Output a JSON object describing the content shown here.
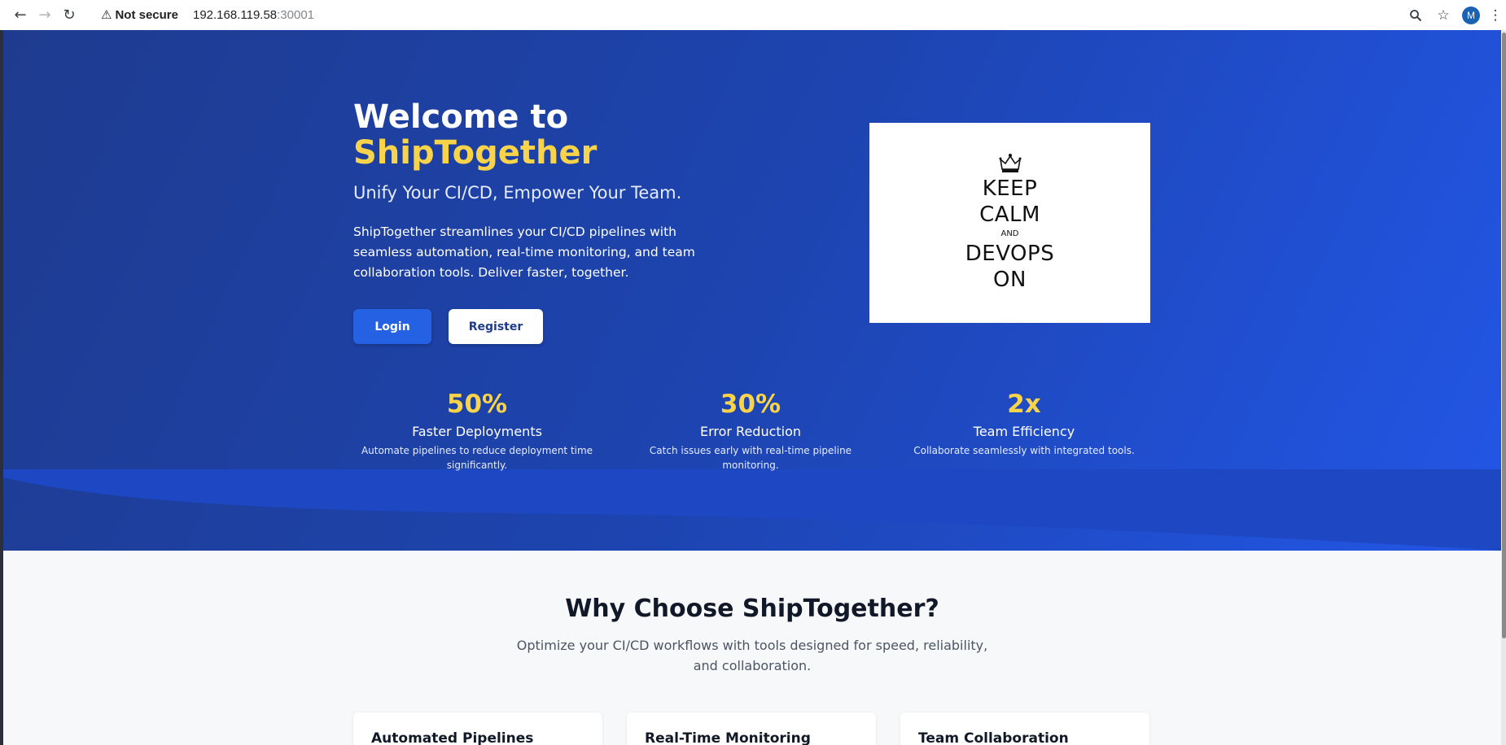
{
  "browser": {
    "security_label": "Not secure",
    "url_host": "192.168.119.58",
    "url_port": ":30001",
    "avatar_letter": "M"
  },
  "hero": {
    "title_line1": "Welcome to",
    "title_line2": "ShipTogether",
    "tagline": "Unify Your CI/CD, Empower Your Team.",
    "description": "ShipTogether streamlines your CI/CD pipelines with seamless automation, real-time monitoring, and team collaboration tools. Deliver faster, together.",
    "login_label": "Login",
    "register_label": "Register"
  },
  "poster": {
    "line1": "KEEP",
    "line2": "CALM",
    "line3": "AND",
    "line4": "DEVOPS",
    "line5": "ON"
  },
  "stats": [
    {
      "value": "50%",
      "title": "Faster Deployments",
      "description": "Automate pipelines to reduce deployment time significantly."
    },
    {
      "value": "30%",
      "title": "Error Reduction",
      "description": "Catch issues early with real-time pipeline monitoring."
    },
    {
      "value": "2x",
      "title": "Team Efficiency",
      "description": "Collaborate seamlessly with integrated tools."
    }
  ],
  "why": {
    "title": "Why Choose ShipTogether?",
    "subtitle": "Optimize your CI/CD workflows with tools designed for speed, reliability, and collaboration."
  },
  "features": [
    {
      "title": "Automated Pipelines"
    },
    {
      "title": "Real-Time Monitoring"
    },
    {
      "title": "Team Collaboration"
    }
  ],
  "colors": {
    "hero_start": "#1e3b8f",
    "hero_end": "#2256e6",
    "accent_yellow": "#f9d44a",
    "primary_button": "#2461e3"
  }
}
